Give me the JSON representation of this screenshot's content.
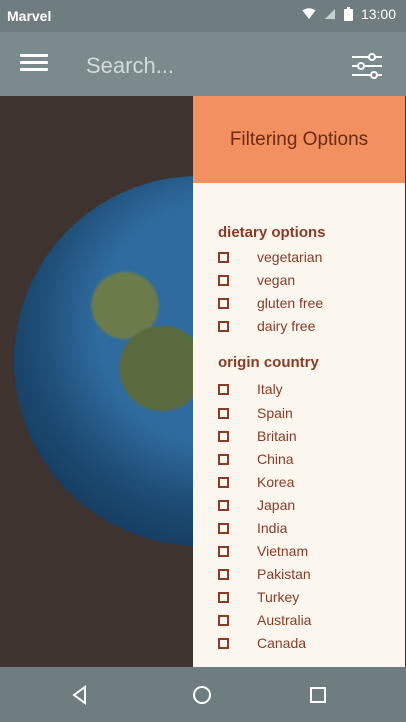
{
  "status_bar": {
    "carrier": "Marvel",
    "time": "13:00",
    "icons": [
      "wifi-icon",
      "signal-icon",
      "battery-icon"
    ]
  },
  "app_bar": {
    "menu_icon": "menu-icon",
    "search_placeholder": "Search...",
    "search_value": "",
    "filter_icon": "filter-sliders-icon"
  },
  "filter_panel": {
    "title": "Filtering Options",
    "dietary": {
      "title": "dietary options",
      "options": [
        "vegetarian",
        "vegan",
        "gluten free",
        "dairy free"
      ]
    },
    "origin": {
      "title": "origin country",
      "options": [
        "Italy",
        "Spain",
        "Britain",
        "China",
        "Korea",
        "Japan",
        "India",
        "Vietnam",
        "Pakistan",
        "Turkey",
        "Australia",
        "Canada"
      ]
    }
  },
  "nav_bar": {
    "icons": [
      "back-icon",
      "home-icon",
      "recents-icon"
    ]
  },
  "colors": {
    "accent": "#f2915f",
    "bar": "#7b8a8d",
    "panel": "#fbf7ee",
    "text": "#8a3b25"
  }
}
